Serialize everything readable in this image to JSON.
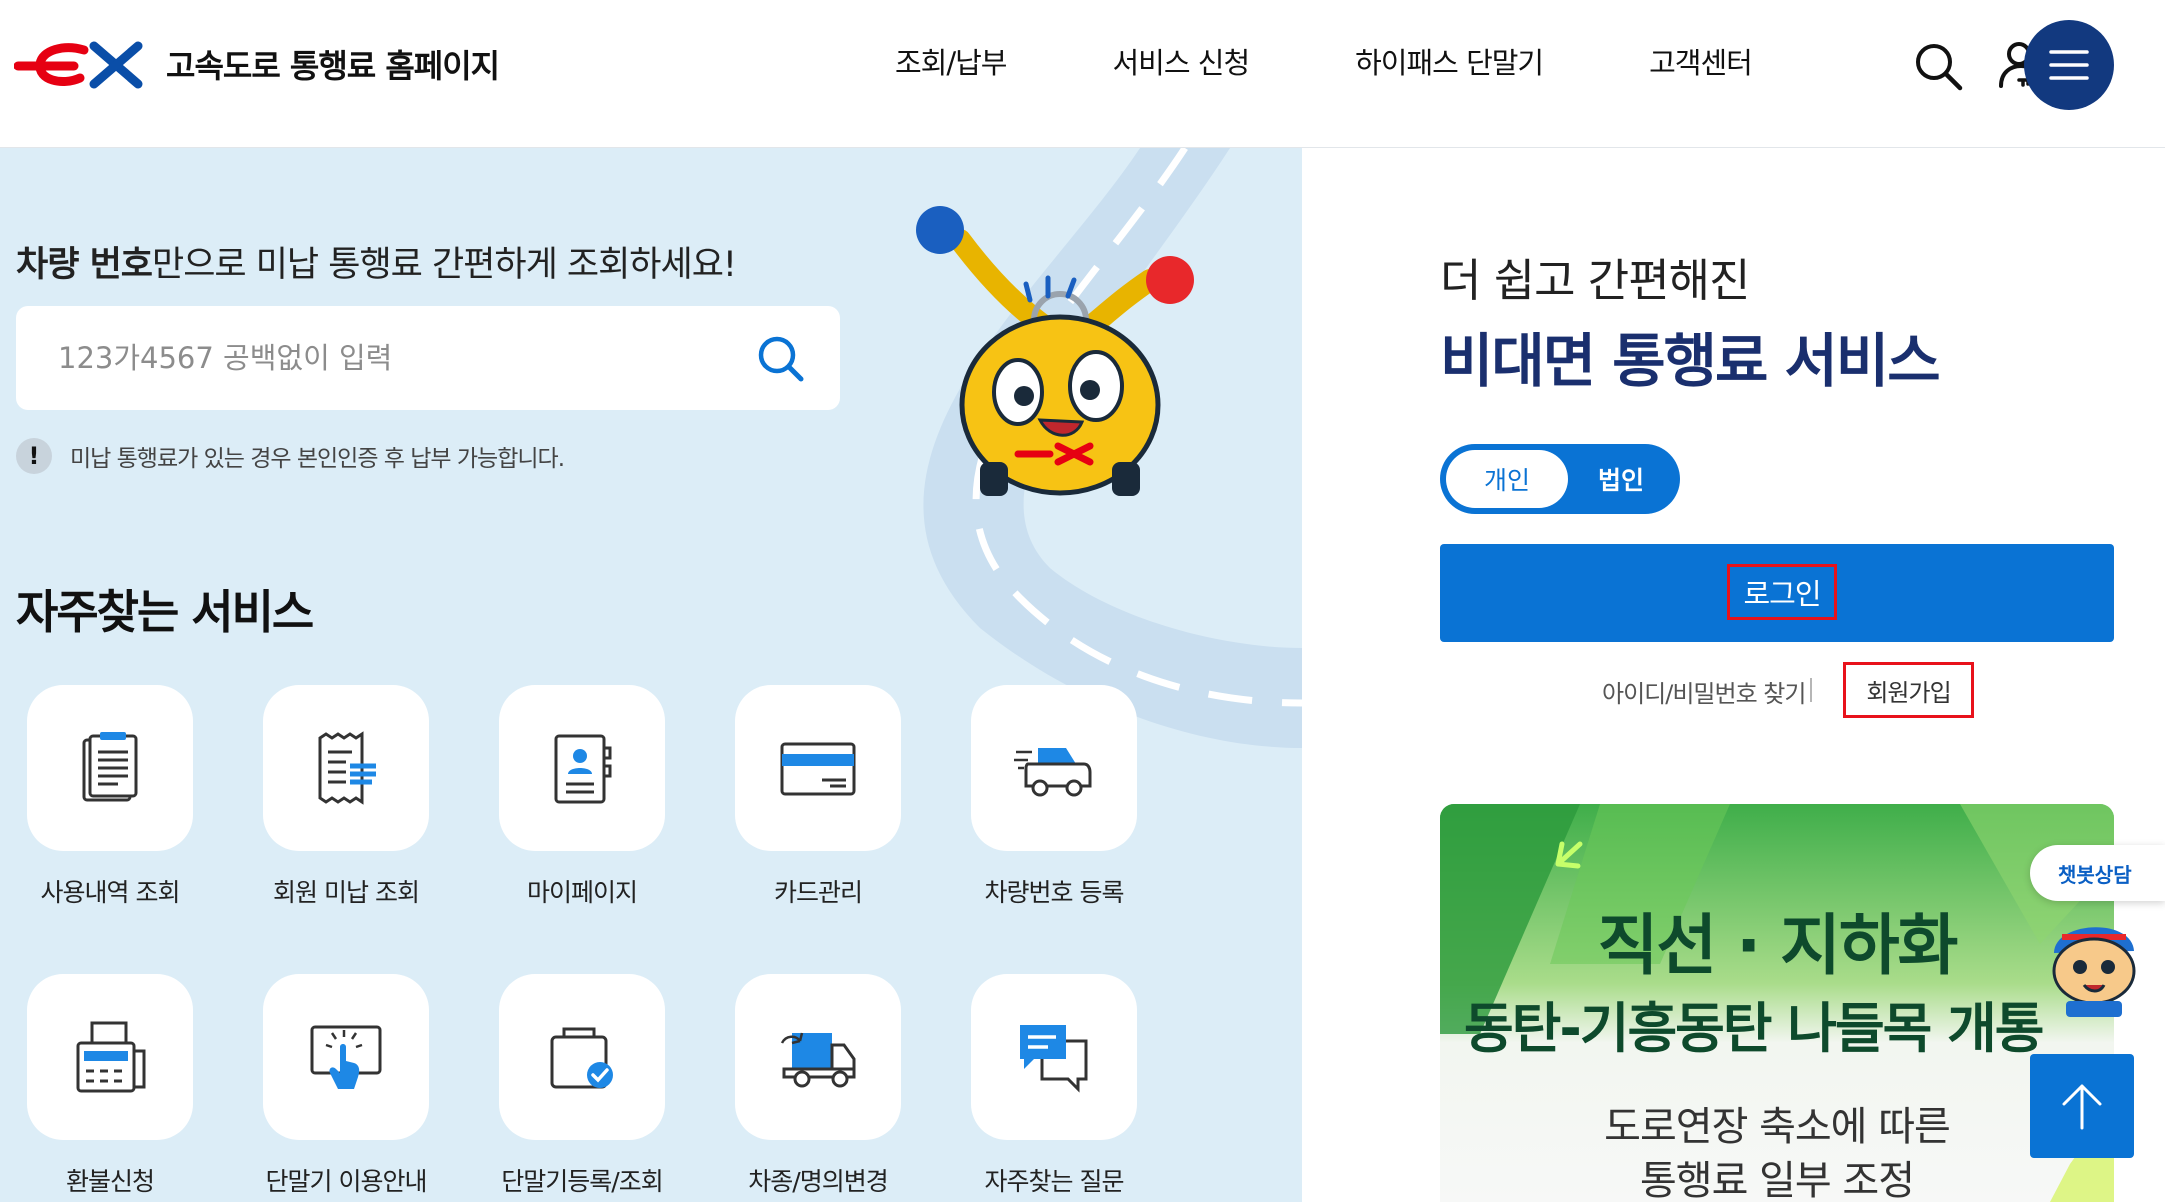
{
  "header": {
    "site_name": "고속도로 통행료 홈페이지",
    "nav": [
      "조회/납부",
      "서비스 신청",
      "하이패스 단말기",
      "고객센터"
    ]
  },
  "lookup": {
    "title_bold": "차량 번호",
    "title_rest": "만으로 미납 통행료 간편하게 조회하세요!",
    "placeholder": "123가4567 공백없이 입력",
    "notice_badge": "!",
    "notice": "미납 통행료가 있는 경우 본인인증 후 납부 가능합니다."
  },
  "services": {
    "title": "자주찾는 서비스",
    "items": [
      {
        "label": "사용내역 조회",
        "icon": "document-list-icon"
      },
      {
        "label": "회원 미납 조회",
        "icon": "receipt-icon"
      },
      {
        "label": "마이페이지",
        "icon": "profile-book-icon"
      },
      {
        "label": "카드관리",
        "icon": "credit-card-icon"
      },
      {
        "label": "차량번호 등록",
        "icon": "car-icon"
      },
      {
        "label": "환불신청",
        "icon": "fax-machine-icon"
      },
      {
        "label": "단말기 이용안내",
        "icon": "touch-screen-icon"
      },
      {
        "label": "단말기등록/조회",
        "icon": "device-check-icon"
      },
      {
        "label": "차종/명의변경",
        "icon": "truck-icon"
      },
      {
        "label": "자주찾는 질문",
        "icon": "chat-icon"
      }
    ]
  },
  "login_panel": {
    "subtitle": "더 쉽고 간편해진",
    "title": "비대면 통행료 서비스",
    "toggle": [
      "개인",
      "법인"
    ],
    "login_label": "로그인",
    "find_label": "아이디/비밀번호 찾기",
    "join_label": "회원가입"
  },
  "banner": {
    "headline": "직선 · 지하화",
    "subline": "동탄-기흥동탄 나들목 개통",
    "desc1": "도로연장 축소에 따른",
    "desc2": "통행료 일부 조정"
  },
  "chatbot": {
    "label": "챗봇상담"
  },
  "colors": {
    "primary": "#0a73d4",
    "navy": "#12397f",
    "title_navy": "#1a2f6e",
    "highlight": "#e8121b",
    "panel_bg": "#dcedf7"
  }
}
